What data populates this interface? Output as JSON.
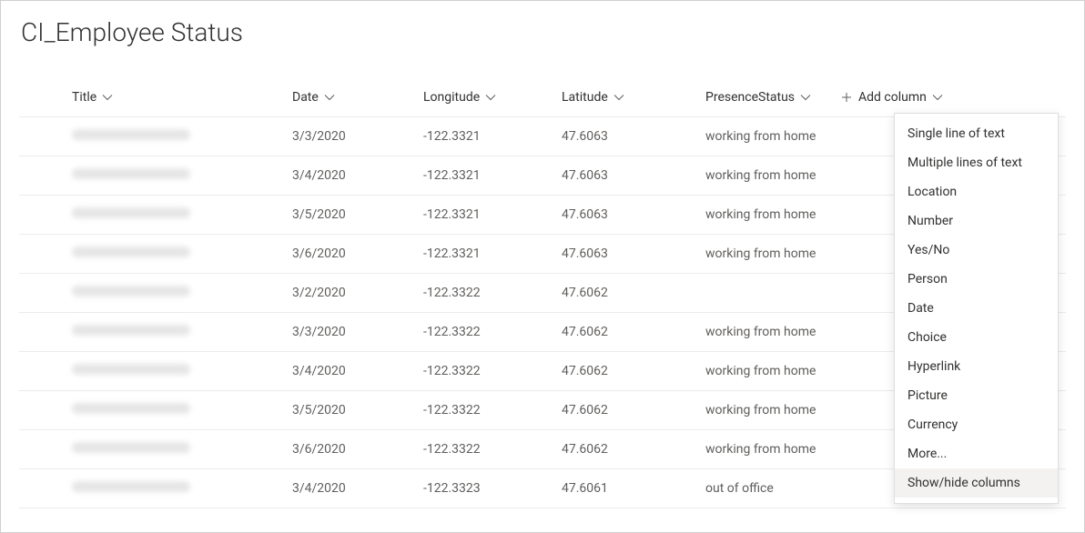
{
  "list": {
    "title": "CI_Employee Status",
    "columns": {
      "title": "Title",
      "date": "Date",
      "longitude": "Longitude",
      "latitude": "Latitude",
      "presenceStatus": "PresenceStatus",
      "addColumn": "Add column"
    },
    "rows": [
      {
        "date": "3/3/2020",
        "longitude": "-122.3321",
        "latitude": "47.6063",
        "presenceStatus": "working from home"
      },
      {
        "date": "3/4/2020",
        "longitude": "-122.3321",
        "latitude": "47.6063",
        "presenceStatus": "working from home"
      },
      {
        "date": "3/5/2020",
        "longitude": "-122.3321",
        "latitude": "47.6063",
        "presenceStatus": "working from home"
      },
      {
        "date": "3/6/2020",
        "longitude": "-122.3321",
        "latitude": "47.6063",
        "presenceStatus": "working from home"
      },
      {
        "date": "3/2/2020",
        "longitude": "-122.3322",
        "latitude": "47.6062",
        "presenceStatus": ""
      },
      {
        "date": "3/3/2020",
        "longitude": "-122.3322",
        "latitude": "47.6062",
        "presenceStatus": "working from home"
      },
      {
        "date": "3/4/2020",
        "longitude": "-122.3322",
        "latitude": "47.6062",
        "presenceStatus": "working from home"
      },
      {
        "date": "3/5/2020",
        "longitude": "-122.3322",
        "latitude": "47.6062",
        "presenceStatus": "working from home"
      },
      {
        "date": "3/6/2020",
        "longitude": "-122.3322",
        "latitude": "47.6062",
        "presenceStatus": "working from home"
      },
      {
        "date": "3/4/2020",
        "longitude": "-122.3323",
        "latitude": "47.6061",
        "presenceStatus": "out of office"
      }
    ]
  },
  "dropdown": {
    "items": [
      "Single line of text",
      "Multiple lines of text",
      "Location",
      "Number",
      "Yes/No",
      "Person",
      "Date",
      "Choice",
      "Hyperlink",
      "Picture",
      "Currency",
      "More...",
      "Show/hide columns"
    ],
    "highlightedIndex": 12
  }
}
